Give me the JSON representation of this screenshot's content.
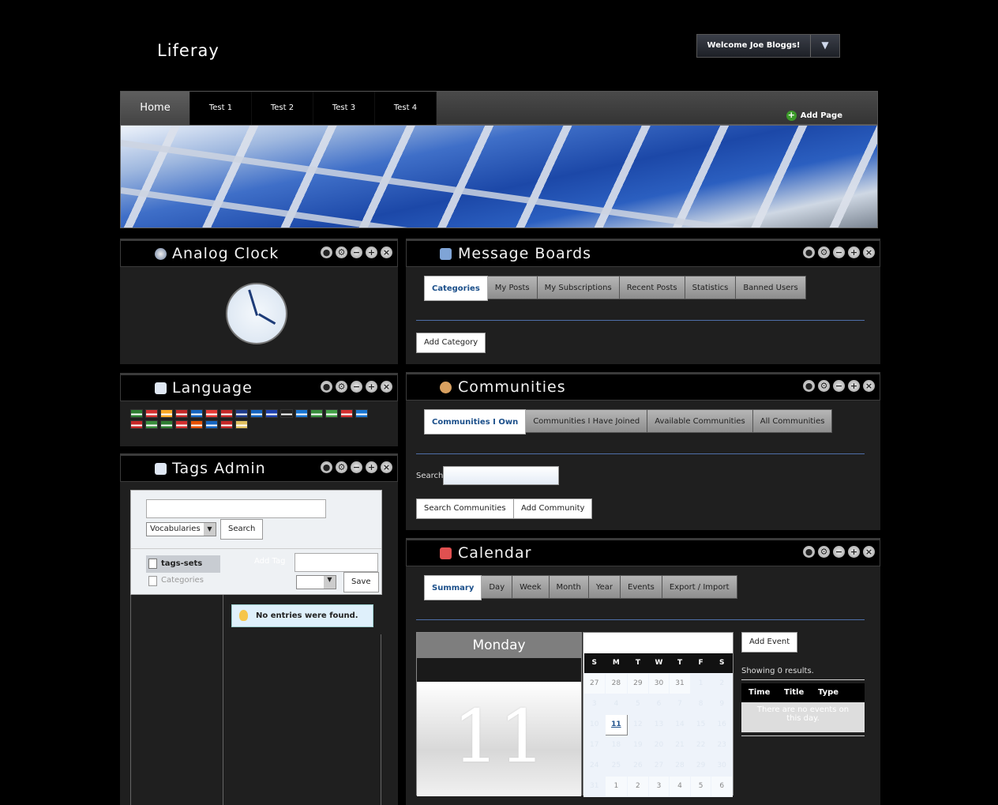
{
  "header": {
    "logo": "Liferay",
    "welcome": "Welcome Joe Bloggs!",
    "welcome_menu_icon": "chevron-down-icon"
  },
  "nav": {
    "tabs": [
      "Home",
      "Test 1",
      "Test 2",
      "Test 3",
      "Test 4"
    ],
    "add_page": "Add Page"
  },
  "analog_clock": {
    "title": "Analog Clock"
  },
  "language": {
    "title": "Language",
    "flags": [
      "#2e7d32",
      "#d32f2f",
      "#f9a825",
      "#c62828",
      "#1565c0",
      "#e53935",
      "#c62828",
      "#1e3a8a",
      "#1565c0",
      "#1e40af",
      "#212121",
      "#1976d2",
      "#388e3c",
      "#43a047",
      "#d32f2f",
      "#1976d2",
      "#c62828",
      "#388e3c",
      "#2e7d32",
      "#d32f2f",
      "#e65100",
      "#1565c0",
      "#c62828",
      "#e0c060"
    ]
  },
  "tags_admin": {
    "title": "Tags Admin",
    "select_value": "Vocabularies",
    "search_button": "Search",
    "vocab_items": [
      "tags-sets",
      "Categories"
    ],
    "add_tag_label": "Add Tag",
    "save_button": "Save",
    "empty_message": "No entries were found."
  },
  "message_boards": {
    "title": "Message Boards",
    "tabs": [
      "Categories",
      "My Posts",
      "My Subscriptions",
      "Recent Posts",
      "Statistics",
      "Banned Users"
    ],
    "add_button": "Add Category"
  },
  "communities": {
    "title": "Communities",
    "tabs": [
      "Communities I Own",
      "Communities I Have Joined",
      "Available Communities",
      "All Communities"
    ],
    "search_label": "Search",
    "search_button": "Search Communities",
    "add_button": "Add Community"
  },
  "calendar": {
    "title": "Calendar",
    "tabs": [
      "Summary",
      "Day",
      "Week",
      "Month",
      "Year",
      "Events",
      "Export / Import"
    ],
    "day_name": "Monday",
    "day_number": "11",
    "weekdays": [
      "S",
      "M",
      "T",
      "W",
      "T",
      "F",
      "S"
    ],
    "weeks": [
      [
        "27",
        "28",
        "29",
        "30",
        "31",
        "1",
        "2"
      ],
      [
        "3",
        "4",
        "5",
        "6",
        "7",
        "8",
        "9"
      ],
      [
        "10",
        "11",
        "12",
        "13",
        "14",
        "15",
        "16"
      ],
      [
        "17",
        "18",
        "19",
        "20",
        "21",
        "22",
        "23"
      ],
      [
        "24",
        "25",
        "26",
        "27",
        "28",
        "29",
        "30"
      ],
      [
        "31",
        "1",
        "2",
        "3",
        "4",
        "5",
        "6"
      ]
    ],
    "add_event": "Add Event",
    "showing": "Showing 0 results.",
    "event_columns": [
      "Time",
      "Title",
      "Type"
    ],
    "no_events": "There are no events on this day."
  }
}
